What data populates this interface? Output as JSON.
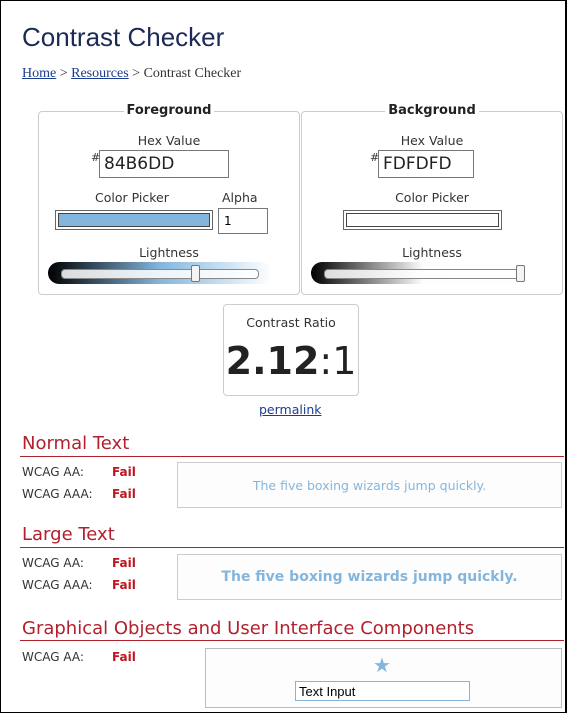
{
  "header": {
    "title": "Contrast Checker",
    "breadcrumb": {
      "home": "Home",
      "sep1": ">",
      "resources": "Resources",
      "sep2": ">",
      "current": "Contrast Checker"
    }
  },
  "foreground": {
    "legend": "Foreground",
    "hex_label": "Hex Value",
    "hash": "#",
    "hex_value": "84B6DD",
    "color_picker_label": "Color Picker",
    "alpha_label": "Alpha",
    "alpha_value": "1",
    "lightness_label": "Lightness",
    "lightness_value": 0.68,
    "color": "#84B6DD"
  },
  "background": {
    "legend": "Background",
    "hex_label": "Hex Value",
    "hash": "#",
    "hex_value": "FDFDFD",
    "color_picker_label": "Color Picker",
    "lightness_label": "Lightness",
    "lightness_value": 0.99,
    "color": "#FDFDFD"
  },
  "contrast": {
    "label": "Contrast Ratio",
    "ratio": "2.12",
    "suffix": ":1",
    "permalink": "permalink"
  },
  "normal_text": {
    "title": "Normal Text",
    "aa_label": "WCAG AA:",
    "aa_result": "Fail",
    "aaa_label": "WCAG AAA:",
    "aaa_result": "Fail",
    "sample": "The five boxing wizards jump quickly."
  },
  "large_text": {
    "title": "Large Text",
    "aa_label": "WCAG AA:",
    "aa_result": "Fail",
    "aaa_label": "WCAG AAA:",
    "aaa_result": "Fail",
    "sample": "The five boxing wizards jump quickly."
  },
  "graphical": {
    "title": "Graphical Objects and User Interface Components",
    "aa_label": "WCAG AA:",
    "aa_result": "Fail",
    "input_value": "Text Input",
    "icon": "star-icon"
  },
  "colors": {
    "accent_red": "#B21F2D",
    "fail_red": "#C0141E",
    "link": "#1A3D8F",
    "title_navy": "#1B2A57"
  }
}
